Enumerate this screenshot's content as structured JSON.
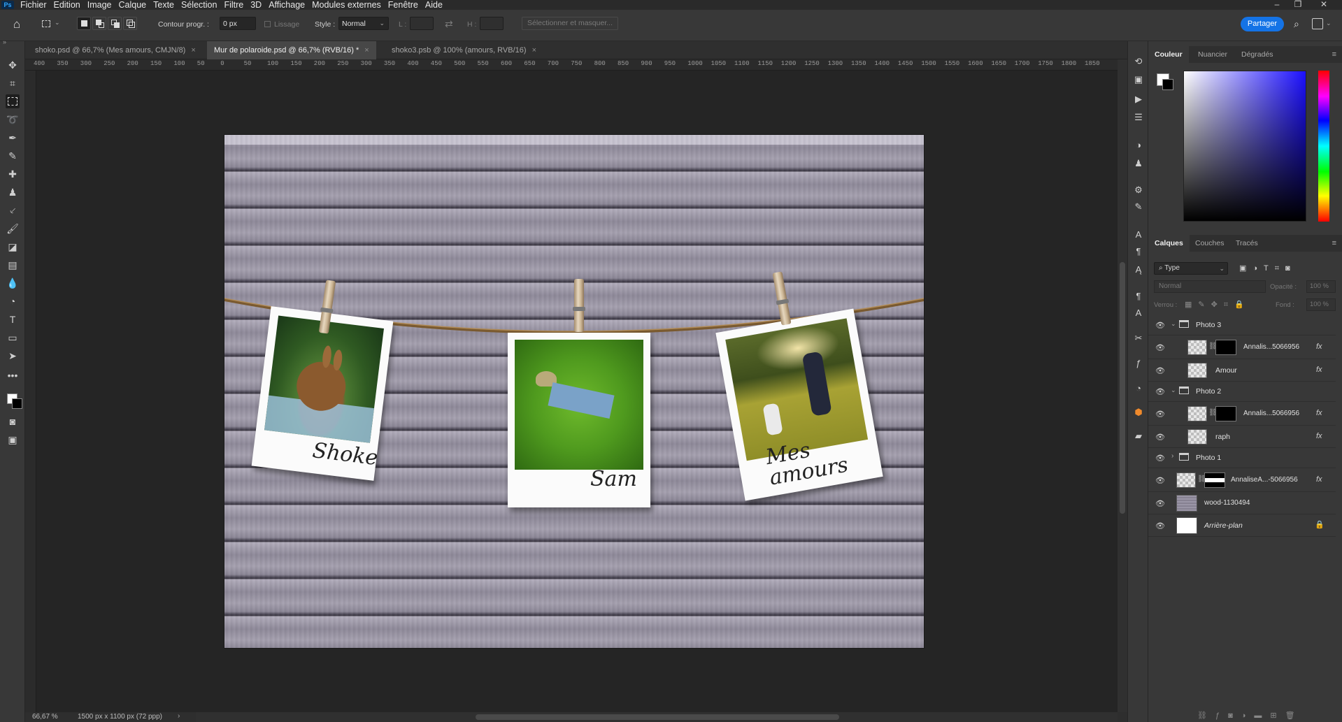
{
  "app": {
    "logo": "Ps",
    "menu": [
      "Fichier",
      "Edition",
      "Image",
      "Calque",
      "Texte",
      "Sélection",
      "Filtre",
      "3D",
      "Affichage",
      "Modules externes",
      "Fenêtre",
      "Aide"
    ]
  },
  "options": {
    "feather_label": "Contour progr. :",
    "feather_value": "0 px",
    "antialias_label": "Lissage",
    "style_label": "Style :",
    "style_value": "Normal",
    "w_label": "L :",
    "h_label": "H :",
    "select_mask": "Sélectionner et masquer...",
    "share": "Partager"
  },
  "tabs": [
    {
      "label": "shoko.psd @ 66,7% (Mes amours, CMJN/8)",
      "close": "×"
    },
    {
      "label": "Mur de polaroide.psd @ 66,7% (RVB/16) *",
      "close": "×"
    },
    {
      "label": "shoko3.psb @ 100% (amours, RVB/16)",
      "close": "×"
    }
  ],
  "ruler_ticks": [
    "400",
    "350",
    "300",
    "250",
    "200",
    "150",
    "100",
    "50",
    "0",
    "50",
    "100",
    "150",
    "200",
    "250",
    "300",
    "350",
    "400",
    "450",
    "500",
    "550",
    "600",
    "650",
    "700",
    "750",
    "800",
    "850",
    "900",
    "950",
    "1000",
    "1050",
    "1100",
    "1150",
    "1200",
    "1250",
    "1300",
    "1350",
    "1400",
    "1450",
    "1500",
    "1550",
    "1600",
    "1650",
    "1700",
    "1750",
    "1800",
    "1850"
  ],
  "canvas": {
    "captions": [
      "Shoke",
      "Sam",
      "Mes\namours"
    ]
  },
  "panels": {
    "color_tabs": [
      "Couleur",
      "Nuancier",
      "Dégradés"
    ],
    "layer_tabs": [
      "Calques",
      "Couches",
      "Tracés"
    ],
    "filter_kind": "Type",
    "blend_mode": "Normal",
    "opacity_label": "Opacité :",
    "opacity_value": "100 %",
    "lock_label": "Verrou :",
    "fill_label": "Fond :",
    "fill_value": "100 %",
    "layers": [
      {
        "name": "Photo 3",
        "type": "group",
        "open": true
      },
      {
        "name": "Annalis...5066956",
        "type": "masked",
        "fx": "fx"
      },
      {
        "name": "Amour",
        "type": "smart",
        "fx": "fx"
      },
      {
        "name": "Photo 2",
        "type": "group",
        "open": true
      },
      {
        "name": "Annalis...5066956",
        "type": "masked",
        "fx": "fx"
      },
      {
        "name": "raph",
        "type": "smart",
        "fx": "fx"
      },
      {
        "name": "Photo 1",
        "type": "group",
        "open": false
      },
      {
        "name": "AnnaliseA...-5066956",
        "type": "masked",
        "fx": "fx"
      },
      {
        "name": "wood-1130494",
        "type": "image"
      },
      {
        "name": "Arrière-plan",
        "type": "background"
      }
    ]
  },
  "status": {
    "zoom": "66,67 %",
    "doc_info": "1500 px x 1100 px (72 ppp)"
  }
}
